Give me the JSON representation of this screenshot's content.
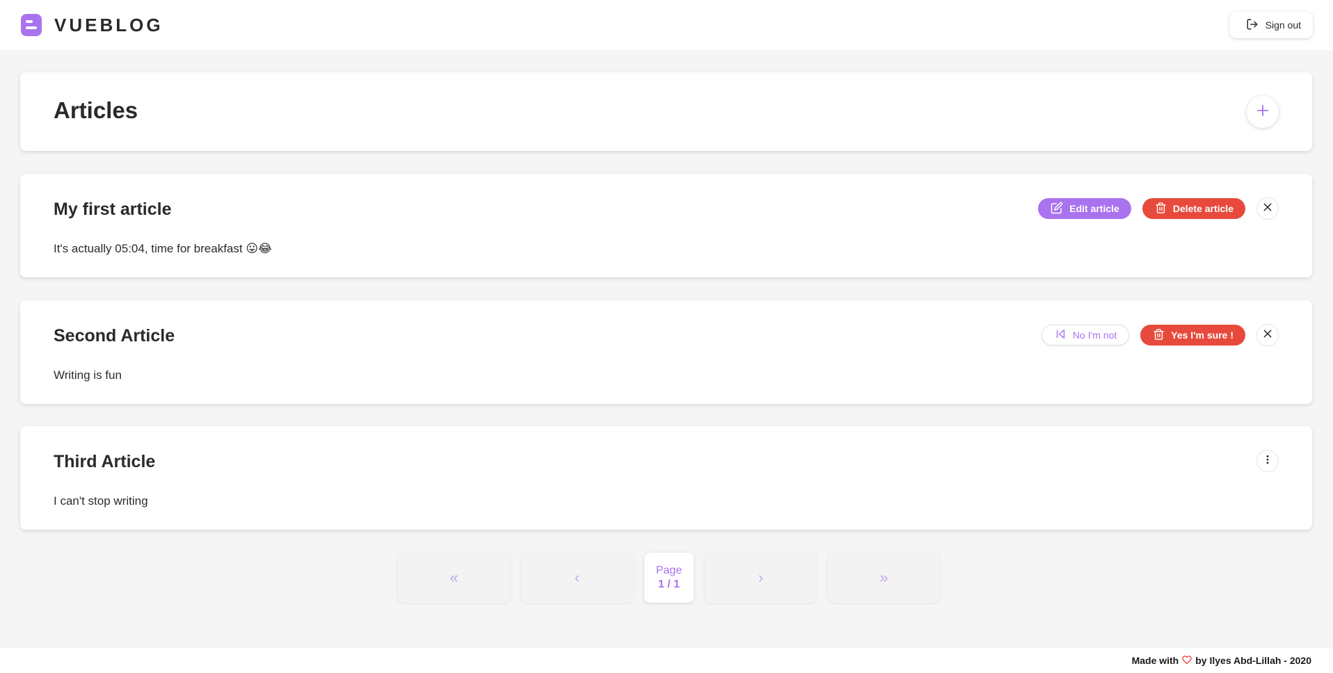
{
  "app": {
    "brand_name": "VUEBLOG",
    "brand_color": "#a972ee",
    "signout_label": "Sign out"
  },
  "header": {
    "title": "Articles",
    "add_icon": "plus-icon"
  },
  "articles": [
    {
      "title": "My first article",
      "body": "It's actually 05:04, time for breakfast 😛😂",
      "actions": {
        "edit_label": "Edit article",
        "delete_label": "Delete article",
        "close_icon": "close-icon"
      }
    },
    {
      "title": "Second Article",
      "body": "Writing is fun",
      "actions": {
        "cancel_label": "No I'm not",
        "confirm_label": "Yes I'm sure !",
        "close_icon": "close-icon"
      }
    },
    {
      "title": "Third Article",
      "body": "I can't stop writing",
      "actions": {
        "menu_icon": "more-vertical-icon"
      }
    }
  ],
  "pagination": {
    "first": "«",
    "prev": "‹",
    "next": "›",
    "last": "»",
    "page_label": "Page",
    "page_value": "1 / 1"
  },
  "footer": {
    "made_with": "Made with",
    "by_text": "by Ilyes Abd-Lillah - 2020"
  },
  "colors": {
    "accent": "#a972ee",
    "danger": "#e74a3c",
    "background": "#f5f5f5"
  }
}
